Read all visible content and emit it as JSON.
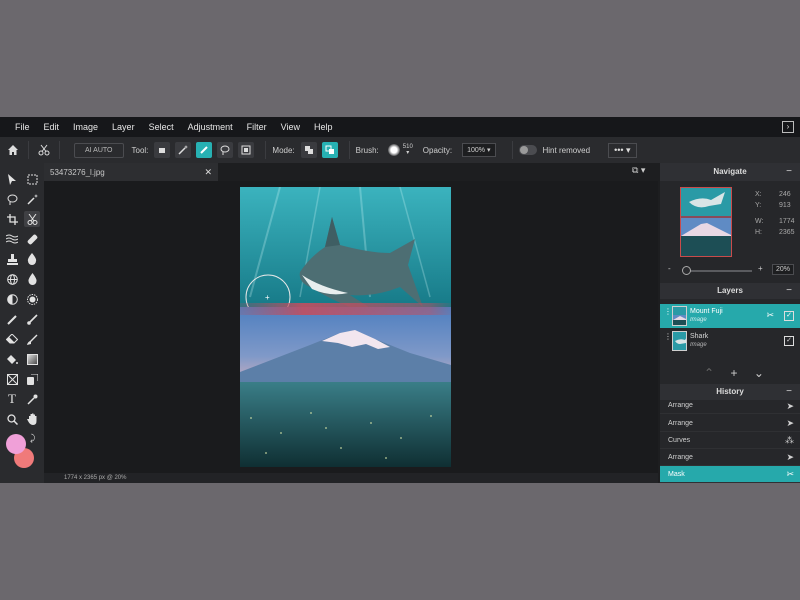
{
  "menu": [
    "File",
    "Edit",
    "Image",
    "Layer",
    "Select",
    "Adjustment",
    "Filter",
    "View",
    "Help"
  ],
  "toolbar": {
    "ai_auto": "AI AUTO",
    "tool_label": "Tool:",
    "mode_label": "Mode:",
    "brush_label": "Brush:",
    "brush_size": "510",
    "opacity_label": "Opacity:",
    "opacity_value": "100%",
    "hint_removed": "Hint removed",
    "more": "•••"
  },
  "document": {
    "tab_name": "53473276_l.jpg",
    "status": "1774 x 2365 px @ 20%"
  },
  "navigate": {
    "title": "Navigate",
    "x_label": "X:",
    "x_value": "246",
    "y_label": "Y:",
    "y_value": "913",
    "w_label": "W:",
    "w_value": "1774",
    "h_label": "H:",
    "h_value": "2365",
    "zoom_minus": "-",
    "zoom_plus": "+",
    "zoom_value": "20%",
    "zoom_level": 0.05
  },
  "layers": {
    "title": "Layers",
    "items": [
      {
        "name": "Mount Fuji",
        "type": "Image",
        "active": true
      },
      {
        "name": "Shark",
        "type": "Image",
        "active": false
      }
    ]
  },
  "history": {
    "title": "History",
    "items": [
      {
        "label": "Arrange",
        "icon": "cursor-icon"
      },
      {
        "label": "Arrange",
        "icon": "cursor-icon"
      },
      {
        "label": "Curves",
        "icon": "curves-icon"
      },
      {
        "label": "Arrange",
        "icon": "cursor-icon"
      },
      {
        "label": "Mask",
        "icon": "scissors-icon",
        "active": true
      }
    ]
  },
  "colors": {
    "accent": "#27b1b3",
    "foreground": "#f0a0d8",
    "background": "#f07a7a"
  }
}
